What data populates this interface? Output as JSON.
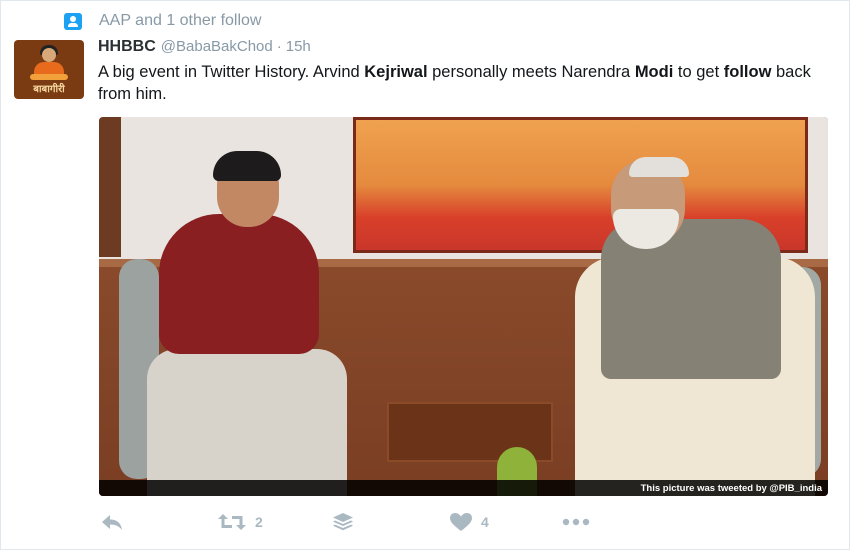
{
  "social_context": {
    "text": "AAP and 1 other follow",
    "icon": "person-follow-icon"
  },
  "tweet": {
    "display_name": "HHBBC",
    "handle": "@BabaBakChod",
    "separator": "·",
    "time": "15h",
    "avatar_text": "बाबागीरी",
    "text_segments": [
      {
        "text": "A big event in Twitter History. Arvind ",
        "bold": false
      },
      {
        "text": "Kejriwal",
        "bold": true
      },
      {
        "text": " personally meets Narendra ",
        "bold": false
      },
      {
        "text": "Modi",
        "bold": true
      },
      {
        "text": " to get ",
        "bold": false
      },
      {
        "text": "follow",
        "bold": true
      },
      {
        "text": " back from him.",
        "bold": false
      }
    ],
    "media": {
      "caption": "This picture was tweeted by @PIB_india"
    }
  },
  "actions": {
    "reply": {
      "icon": "reply-icon"
    },
    "retweet": {
      "icon": "retweet-icon",
      "count": "2"
    },
    "buffer": {
      "icon": "layers-icon"
    },
    "like": {
      "icon": "heart-icon",
      "count": "4"
    },
    "more": {
      "icon": "more-icon"
    }
  },
  "colors": {
    "accent": "#1da1f2",
    "muted": "#8899a6",
    "action": "#aab8c2"
  }
}
